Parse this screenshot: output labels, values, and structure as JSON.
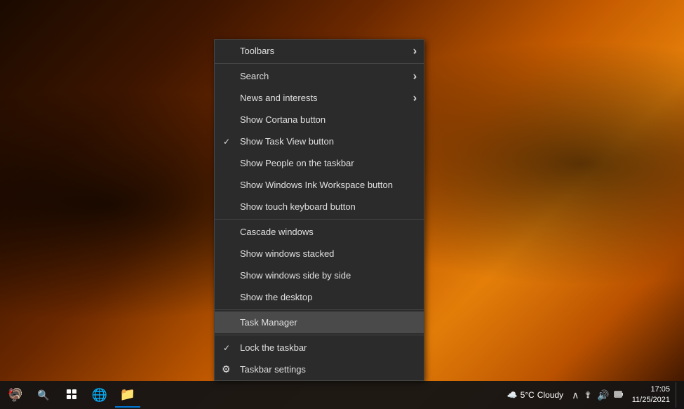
{
  "desktop": {
    "background_desc": "Autumn forest with orange-red foliage"
  },
  "context_menu": {
    "items": [
      {
        "id": "toolbars",
        "label": "Toolbars",
        "type": "submenu",
        "checked": false,
        "separator_after": false
      },
      {
        "id": "search",
        "label": "Search",
        "type": "submenu",
        "checked": false,
        "separator_after": false
      },
      {
        "id": "news_interests",
        "label": "News and interests",
        "type": "submenu",
        "checked": false,
        "separator_after": false
      },
      {
        "id": "show_cortana",
        "label": "Show Cortana button",
        "type": "normal",
        "checked": false,
        "separator_after": false
      },
      {
        "id": "show_task_view",
        "label": "Show Task View button",
        "type": "normal",
        "checked": true,
        "separator_after": false
      },
      {
        "id": "show_people",
        "label": "Show People on the taskbar",
        "type": "normal",
        "checked": false,
        "separator_after": false
      },
      {
        "id": "show_ink",
        "label": "Show Windows Ink Workspace button",
        "type": "normal",
        "checked": false,
        "separator_after": false
      },
      {
        "id": "show_touch",
        "label": "Show touch keyboard button",
        "type": "normal",
        "checked": false,
        "separator_after": true
      },
      {
        "id": "cascade",
        "label": "Cascade windows",
        "type": "normal",
        "checked": false,
        "separator_after": false
      },
      {
        "id": "stacked",
        "label": "Show windows stacked",
        "type": "normal",
        "checked": false,
        "separator_after": false
      },
      {
        "id": "side_by_side",
        "label": "Show windows side by side",
        "type": "normal",
        "checked": false,
        "separator_after": false
      },
      {
        "id": "show_desktop",
        "label": "Show the desktop",
        "type": "normal",
        "checked": false,
        "separator_after": true
      },
      {
        "id": "task_manager",
        "label": "Task Manager",
        "type": "highlighted",
        "checked": false,
        "separator_after": true
      },
      {
        "id": "lock_taskbar",
        "label": "Lock the taskbar",
        "type": "normal",
        "checked": true,
        "separator_after": false
      },
      {
        "id": "taskbar_settings",
        "label": "Taskbar settings",
        "type": "gear",
        "checked": false,
        "separator_after": false
      }
    ]
  },
  "taskbar": {
    "left_icons": [
      {
        "id": "start",
        "symbol": "🦃",
        "label": "Start"
      },
      {
        "id": "search",
        "symbol": "🔍",
        "label": "Search"
      },
      {
        "id": "task_view",
        "symbol": "⧉",
        "label": "Task View"
      },
      {
        "id": "chrome",
        "symbol": "🌐",
        "label": "Google Chrome"
      },
      {
        "id": "explorer",
        "symbol": "📁",
        "label": "File Explorer"
      }
    ],
    "weather": {
      "icon": "☁",
      "temp": "5°C",
      "condition": "Cloudy"
    },
    "tray_icons": [
      "^",
      "📶",
      "🔊"
    ],
    "clock": {
      "time": "17:05",
      "date": "11/25/2021"
    }
  }
}
